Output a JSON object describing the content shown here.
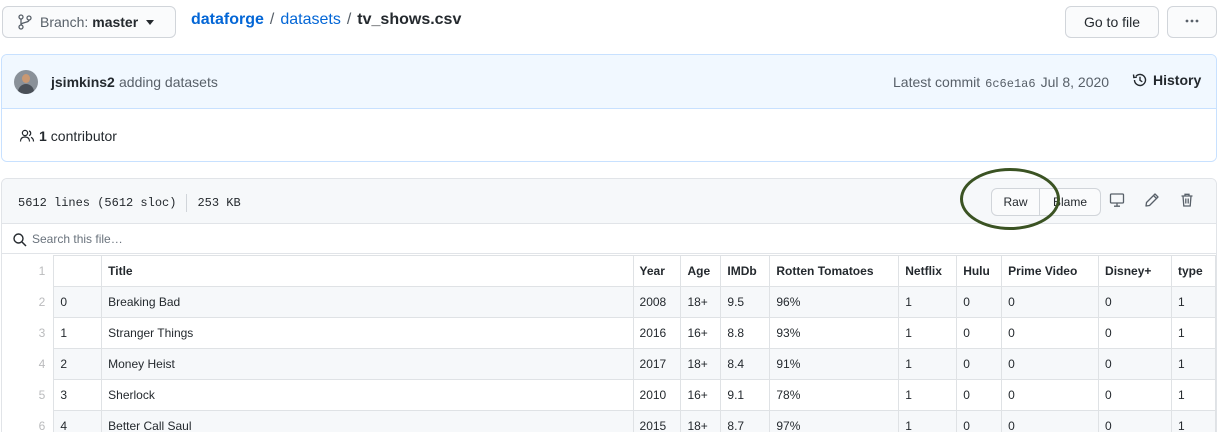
{
  "branch": {
    "label": "Branch:",
    "value": "master"
  },
  "breadcrumb": {
    "owner": "dataforge",
    "folder": "datasets",
    "file": "tv_shows.csv",
    "separator": "/"
  },
  "goto_file_label": "Go to file",
  "commit": {
    "author": "jsimkins2",
    "message": "adding datasets",
    "latest_label": "Latest commit",
    "sha": "6c6e1a6",
    "date": "Jul 8, 2020",
    "history_label": "History"
  },
  "contributors": {
    "count": "1",
    "label": "contributor"
  },
  "file": {
    "lines_info": "5612 lines (5612 sloc)",
    "size": "253 KB",
    "raw_label": "Raw",
    "blame_label": "Blame"
  },
  "search": {
    "placeholder": "Search this file…"
  },
  "table": {
    "header_line": "1",
    "columns": [
      "",
      "Title",
      "Year",
      "Age",
      "IMDb",
      "Rotten Tomatoes",
      "Netflix",
      "Hulu",
      "Prime Video",
      "Disney+",
      "type"
    ],
    "rows": [
      {
        "line": "2",
        "cells": [
          "0",
          "Breaking Bad",
          "2008",
          "18+",
          "9.5",
          "96%",
          "1",
          "0",
          "0",
          "0",
          "1"
        ]
      },
      {
        "line": "3",
        "cells": [
          "1",
          "Stranger Things",
          "2016",
          "16+",
          "8.8",
          "93%",
          "1",
          "0",
          "0",
          "0",
          "1"
        ]
      },
      {
        "line": "4",
        "cells": [
          "2",
          "Money Heist",
          "2017",
          "18+",
          "8.4",
          "91%",
          "1",
          "0",
          "0",
          "0",
          "1"
        ]
      },
      {
        "line": "5",
        "cells": [
          "3",
          "Sherlock",
          "2010",
          "16+",
          "9.1",
          "78%",
          "1",
          "0",
          "0",
          "0",
          "1"
        ]
      },
      {
        "line": "6",
        "cells": [
          "4",
          "Better Call Saul",
          "2015",
          "18+",
          "8.7",
          "97%",
          "1",
          "0",
          "0",
          "0",
          "1"
        ]
      }
    ]
  },
  "colors": {
    "link": "#0366d6",
    "annotation_circle": "#3b5323",
    "commit_bg": "#f1f8ff"
  }
}
